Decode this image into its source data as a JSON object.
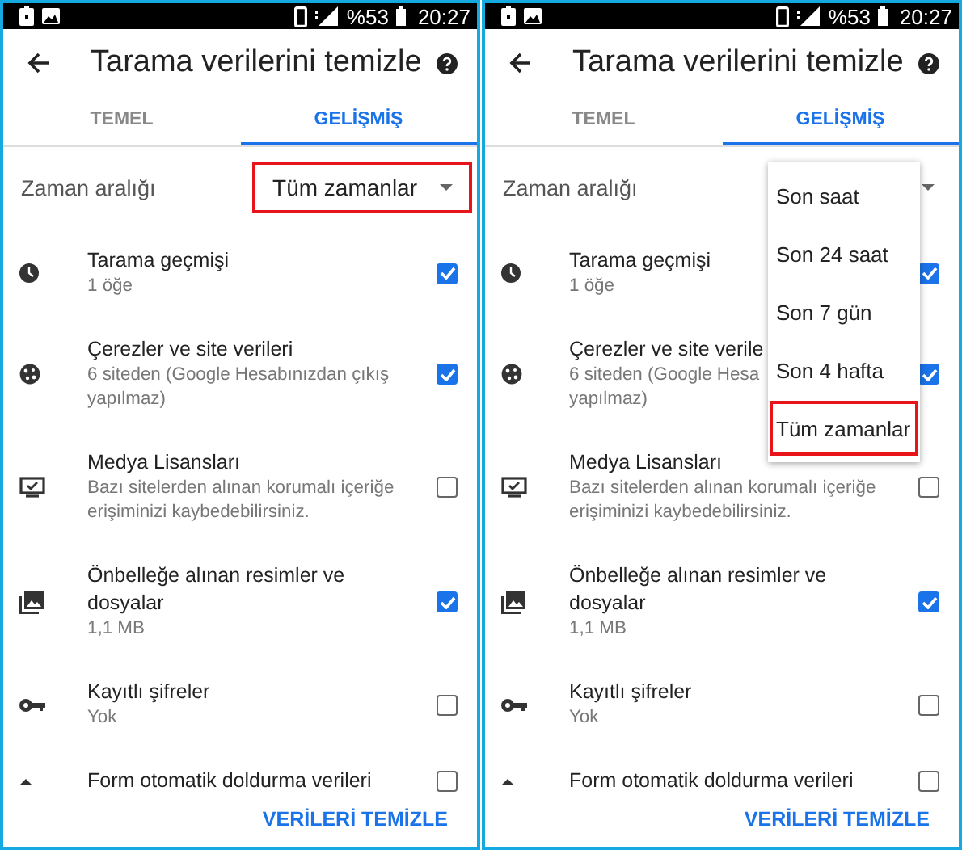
{
  "panels": [
    {
      "status_bar": {
        "battery": "%53",
        "time": "20:27"
      },
      "title": "Tarama verilerini temizle",
      "tabs": [
        {
          "label": "TEMEL",
          "selected": false
        },
        {
          "label": "GELİŞMİŞ",
          "selected": true
        }
      ],
      "time_range": {
        "label": "Zaman aralığı",
        "value": "Tüm zamanlar",
        "highlighted": true
      },
      "items": [
        {
          "kind": "clock",
          "title": "Tarama geçmişi",
          "subtitle": "1 öğe",
          "checked": true
        },
        {
          "kind": "cookie",
          "title": "Çerezler ve site verileri",
          "subtitle": "6 siteden (Google Hesabınızdan çıkış yapılmaz)",
          "checked": true
        },
        {
          "kind": "monitor",
          "title": "Medya Lisansları",
          "subtitle": "Bazı sitelerden alınan korumalı içeriğe erişiminizi kaybedebilirsiniz.",
          "checked": false
        },
        {
          "kind": "images",
          "title": "Önbelleğe alınan resimler ve dosyalar",
          "subtitle": "1,1 MB",
          "checked": true
        },
        {
          "kind": "key",
          "title": "Kayıtlı şifreler",
          "subtitle": "Yok",
          "checked": false
        },
        {
          "kind": "form",
          "title": "Form otomatik doldurma verileri",
          "checked": false
        }
      ],
      "footer_button": "VERİLERİ TEMİZLE"
    },
    {
      "status_bar": {
        "battery": "%53",
        "time": "20:27"
      },
      "title": "Tarama verilerini temizle",
      "tabs": [
        {
          "label": "TEMEL",
          "selected": false
        },
        {
          "label": "GELİŞMİŞ",
          "selected": true
        }
      ],
      "time_range": {
        "label": "Zaman aralığı",
        "highlighted": false
      },
      "menu": {
        "options": [
          {
            "label": "Son saat",
            "highlighted": false
          },
          {
            "label": "Son 24 saat",
            "highlighted": false
          },
          {
            "label": "Son 7 gün",
            "highlighted": false
          },
          {
            "label": "Son 4 hafta",
            "highlighted": false
          },
          {
            "label": "Tüm zamanlar",
            "highlighted": true
          }
        ]
      },
      "items": [
        {
          "kind": "clock",
          "title": "Tarama geçmişi",
          "subtitle": "1 öğe",
          "checked": true
        },
        {
          "kind": "cookie",
          "title": "Çerezler ve site verile",
          "subtitle": "6 siteden (Google Hesa\nyapılmaz)",
          "checked": true
        },
        {
          "kind": "monitor",
          "title": "Medya Lisansları",
          "subtitle": "Bazı sitelerden alınan korumalı içeriğe erişiminizi kaybedebilirsiniz.",
          "checked": false
        },
        {
          "kind": "images",
          "title": "Önbelleğe alınan resimler ve dosyalar",
          "subtitle": "1,1 MB",
          "checked": true
        },
        {
          "kind": "key",
          "title": "Kayıtlı şifreler",
          "subtitle": "Yok",
          "checked": false
        },
        {
          "kind": "form",
          "title": "Form otomatik doldurma verileri",
          "checked": false
        }
      ],
      "footer_button": "VERİLERİ TEMİZLE"
    }
  ]
}
